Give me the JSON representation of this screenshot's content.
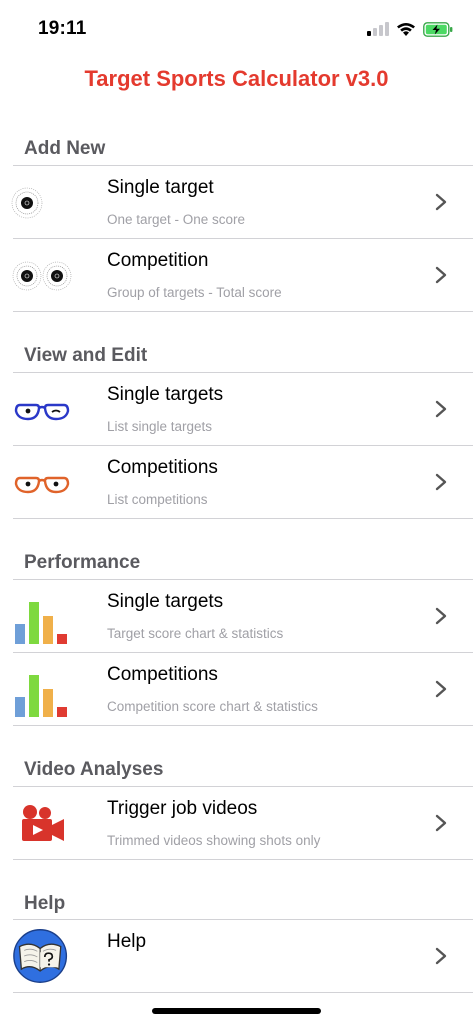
{
  "status_bar": {
    "time": "19:11"
  },
  "app": {
    "title": "Target Sports Calculator v3.0"
  },
  "sections": {
    "add_new": {
      "header": "Add New",
      "items": [
        {
          "title": "Single target",
          "subtitle": "One target - One score",
          "icon": "single-target-icon"
        },
        {
          "title": "Competition",
          "subtitle": "Group of targets - Total score",
          "icon": "double-target-icon"
        }
      ]
    },
    "view_edit": {
      "header": "View and Edit",
      "items": [
        {
          "title": "Single targets",
          "subtitle": "List single targets",
          "icon": "blue-glasses-icon"
        },
        {
          "title": "Competitions",
          "subtitle": "List competitions",
          "icon": "orange-glasses-icon"
        }
      ]
    },
    "performance": {
      "header": "Performance",
      "items": [
        {
          "title": "Single targets",
          "subtitle": "Target score chart & statistics",
          "icon": "bar-chart-icon"
        },
        {
          "title": "Competitions",
          "subtitle": "Competition score chart & statistics",
          "icon": "bar-chart-icon"
        }
      ]
    },
    "video": {
      "header": "Video Analyses",
      "items": [
        {
          "title": "Trigger job videos",
          "subtitle": "Trimmed videos showing shots only",
          "icon": "video-camera-icon"
        }
      ]
    },
    "help": {
      "header": "Help",
      "items": [
        {
          "title": "Help",
          "subtitle": "",
          "icon": "help-book-icon"
        }
      ]
    }
  },
  "colors": {
    "title_red": "#e43a2e",
    "section_gray": "#5a5a5f",
    "subtitle_gray": "#a0a0a6",
    "bar_blue": "#6f9fd8",
    "bar_green": "#7ed93f",
    "bar_orange": "#f0b04a",
    "bar_red": "#e03b32"
  }
}
